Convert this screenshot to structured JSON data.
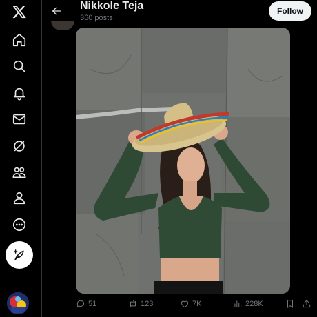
{
  "profile": {
    "name": "Nikkole Teja",
    "post_count": "360 posts"
  },
  "header": {
    "follow_label": "Follow"
  },
  "nav": {
    "items": [
      {
        "name": "x-logo-icon"
      },
      {
        "name": "home-icon"
      },
      {
        "name": "search-icon"
      },
      {
        "name": "notifications-bell-icon"
      },
      {
        "name": "messages-envelope-icon"
      },
      {
        "name": "grok-icon"
      },
      {
        "name": "communities-icon"
      },
      {
        "name": "profile-person-icon"
      },
      {
        "name": "more-circle-icon"
      },
      {
        "name": "compose-post-icon"
      }
    ]
  },
  "post": {
    "replies": "51",
    "reposts": "123",
    "likes": "7K",
    "views": "228K"
  },
  "colors": {
    "background": "#000000",
    "text_primary": "#e7e9ea",
    "text_secondary": "#71767b",
    "follow_button_bg": "#eff3f4",
    "divider": "#2f3336"
  }
}
